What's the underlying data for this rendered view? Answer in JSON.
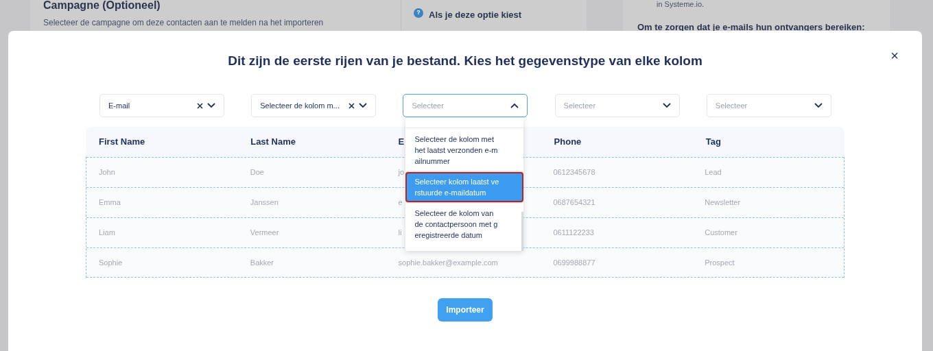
{
  "background": {
    "campaign_title": "Campagne (Optioneel)",
    "campaign_hint": "Selecteer de campagne om deze contacten aan te melden na het importeren",
    "help_icon": "?",
    "help_title": "Als je deze optie kiest",
    "side_note": "in Systeme.io.",
    "side_title": "Om te zorgen dat je e-mails hun ontvangers bereiken:"
  },
  "modal": {
    "title": "Dit zijn de eerste rijen van je bestand. Kies het gegevenstype van elke kolom",
    "close": "×",
    "selects": [
      {
        "value": "E-mail",
        "open": false
      },
      {
        "value": "Selecteer de kolom m...",
        "open": false
      },
      {
        "placeholder": "Selecteer",
        "open": true
      },
      {
        "placeholder": "Selecteer",
        "open": false
      },
      {
        "placeholder": "Selecteer",
        "open": false
      }
    ],
    "dropdown_options": [
      {
        "label": "Selecteer de kolom met het laatst verzonden e-mailnummer",
        "selected": false
      },
      {
        "label": "Selecteer kolom laatst verstuurde e-maildatum",
        "selected": true
      },
      {
        "label": "Selecteer de kolom van de contactpersoon met geregistreerde datum",
        "selected": false
      }
    ],
    "table": {
      "columns": [
        "First Name",
        "Last Name",
        "E",
        "Phone",
        "Tag"
      ],
      "rows": [
        [
          "John",
          "Doe",
          "jo",
          "0612345678",
          "Lead"
        ],
        [
          "Emma",
          "Janssen",
          "e",
          "0687654321",
          "Newsletter"
        ],
        [
          "Liam",
          "Vermeer",
          "li",
          "0611122233",
          "Customer"
        ],
        [
          "Sophie",
          "Bakker",
          "sophie.bakker@example.com",
          "0699988877",
          "Prospect"
        ]
      ]
    },
    "import_button": "Importeer"
  }
}
